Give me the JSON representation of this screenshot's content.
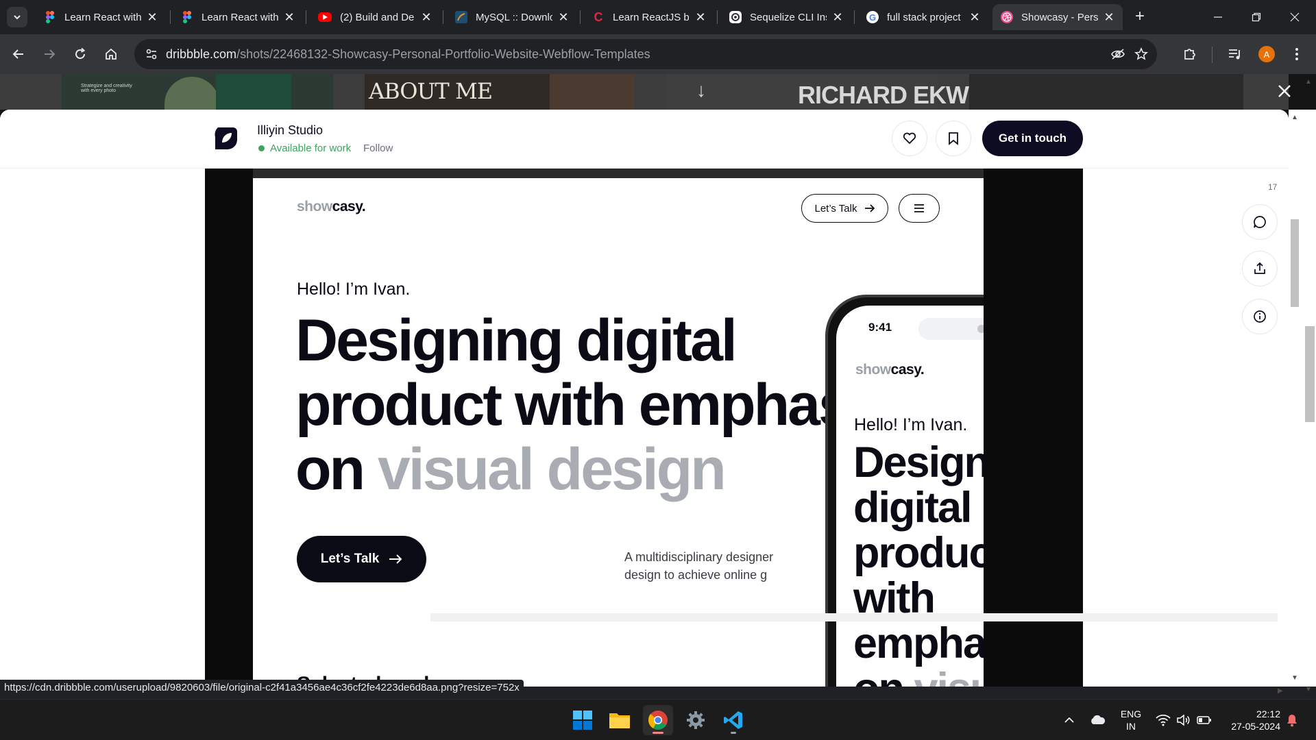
{
  "browser": {
    "tabs": [
      {
        "title": "Learn React with",
        "favicon": "figma-icon"
      },
      {
        "title": "Learn React with",
        "favicon": "figma-icon"
      },
      {
        "title": "(2) Build and De",
        "favicon": "youtube-icon"
      },
      {
        "title": "MySQL :: Downlo",
        "favicon": "mysql-icon"
      },
      {
        "title": "Learn ReactJS by",
        "favicon": "codecademy-icon"
      },
      {
        "title": "Sequelize CLI Ins",
        "favicon": "chatgpt-icon"
      },
      {
        "title": "full stack project",
        "favicon": "google-icon"
      },
      {
        "title": "Showcasy - Perso",
        "favicon": "dribbble-icon",
        "active": true
      }
    ],
    "new_tab_label": "+",
    "close_glyph": "✕",
    "url_domain": "dribbble.com",
    "url_path": "/shots/22468132-Showcasy-Personal-Portfolio-Website-Webflow-Templates",
    "profile_initial": "A"
  },
  "backdrop": {
    "thumbs": [
      "Strategize and creativity with every photo",
      "ABOUT ME",
      "RICHARD EKWONYE"
    ],
    "arrow": "↓"
  },
  "shot_header": {
    "studio_name": "Illiyin Studio",
    "availability": "Available for work",
    "follow": "Follow",
    "cta": "Get in touch"
  },
  "shot": {
    "logo_light": "show",
    "logo_dark": "casy.",
    "nav_talk": "Let’s Talk",
    "hello": "Hello! I’m Ivan.",
    "headline_line1": "Designing digital",
    "headline_line2": "product with emphasis",
    "headline_line3_dark": "on ",
    "headline_line3_grey": "visual design",
    "cta": "Let’s Talk",
    "description_line1": "A multidisciplinary designer",
    "description_line2": "design to achieve online g",
    "bottom_text": "Selected work",
    "phone": {
      "time": "9:41",
      "hello": "Hello! I’m Ivan.",
      "headline_lines": [
        "Designing",
        "digital",
        "product",
        "with",
        "emphasis"
      ],
      "headline_last_dark": "on ",
      "headline_last_grey": "visual"
    }
  },
  "side_actions": {
    "comment_count": "17"
  },
  "status_bar_url": "https://cdn.dribbble.com/userupload/9820603/file/original-c2f41a3456ae4c36cf2fe4223de6d8aa.png?resize=752x",
  "taskbar": {
    "lang_top": "ENG",
    "lang_bottom": "IN",
    "time": "22:12",
    "date": "27-05-2024"
  },
  "colors": {
    "dribbble_pink": "#ea4c89",
    "available_green": "#3ba55c",
    "cta_dark": "#0d0c22",
    "headline_grey": "#a9adb3"
  }
}
